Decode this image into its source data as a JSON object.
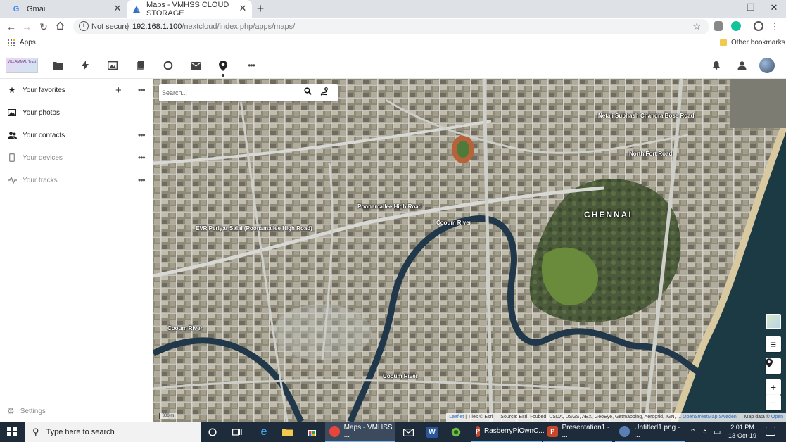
{
  "browser": {
    "tabs": [
      {
        "title": "Gmail",
        "icon": "gmail-icon",
        "active": false
      },
      {
        "title": "Maps - VMHSS CLOUD STORAGE",
        "icon": "maps-tab-icon",
        "active": true
      }
    ],
    "new_tab_label": "+",
    "address": {
      "security_label": "Not secure",
      "host": "192.168.1.100",
      "path": "/nextcloud/index.php/apps/maps/"
    },
    "bookmarks": {
      "apps_label": "Apps",
      "other_label": "Other bookmarks"
    },
    "window_controls": {
      "minimize": "—",
      "maximize": "❐",
      "close": "✕"
    }
  },
  "nextcloud": {
    "logo_text": "VILLAMMAL Trust",
    "apps": [
      "folder-icon",
      "activity-icon",
      "photos-icon",
      "deck-icon",
      "talk-icon",
      "mail-icon",
      "maps-icon",
      "more-apps-icon"
    ],
    "active_app": "maps-icon",
    "header_right": [
      "notifications-icon",
      "contacts-icon",
      "avatar"
    ]
  },
  "sidebar": {
    "items": [
      {
        "label": "Your favorites",
        "icon": "star-icon",
        "add": "+",
        "more": "•••",
        "dim": false
      },
      {
        "label": "Your photos",
        "icon": "image-icon",
        "more": "",
        "dim": false
      },
      {
        "label": "Your contacts",
        "icon": "contacts-icon",
        "more": "•••",
        "dim": false
      },
      {
        "label": "Your devices",
        "icon": "phone-icon",
        "more": "•••",
        "dim": true
      },
      {
        "label": "Your tracks",
        "icon": "track-icon",
        "more": "•••",
        "dim": true
      }
    ],
    "settings_label": "Settings"
  },
  "map": {
    "search_placeholder": "Search...",
    "city_label": "CHENNAI",
    "street_labels": [
      "Poonamallee High Road",
      "EVR Periyar Salai (Poonamallee High Road)",
      "Cooum River",
      "Cooum River",
      "Cooum River",
      "North Fort Road",
      "Netaji Subhash Chandra Bose Road"
    ],
    "controls": {
      "zoom_in": "+",
      "zoom_out": "−",
      "layers": "≡"
    },
    "scale_label": "300 m",
    "attribution": {
      "leaflet": "Leaflet",
      "tiles": " | Tiles © Esri — Source: Esri, i-cubed, USDA, USGS, AEX, GeoEye, Getmapping, Aerogrid, IGN, ...",
      "osm": "OpenStreetMap Sweden",
      "rest": " — Map data © ",
      "open": "Open"
    }
  },
  "taskbar": {
    "search_placeholder": "Type here to search",
    "apps": [
      {
        "label": "Maps - VMHSS ...",
        "icon": "chrome-icon",
        "color": "#e8453c",
        "active": true
      },
      {
        "label": "RasberryPiOwnC...",
        "icon": "powerpoint-icon",
        "color": "#c8462b",
        "active": false
      },
      {
        "label": "Presentation1 - ...",
        "icon": "powerpoint-icon",
        "color": "#c8462b",
        "active": false
      },
      {
        "label": "Untitled1.png - ...",
        "icon": "paint-icon",
        "color": "#5a7fb5",
        "active": false
      }
    ],
    "clock_time": "2:01 PM",
    "clock_date": "13-Oct-19"
  }
}
